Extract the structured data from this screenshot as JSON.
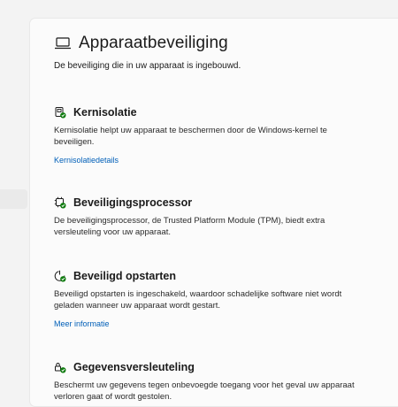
{
  "page": {
    "title": "Apparaatbeveiliging",
    "subtitle": "De beveiliging die in uw apparaat is ingebouwd."
  },
  "sections": [
    {
      "title": "Kernisolatie",
      "description": "Kernisolatie helpt uw apparaat te beschermen door de Windows-kernel te beveiligen.",
      "link": "Kernisolatiedetails",
      "icon": "core-isolation-icon"
    },
    {
      "title": "Beveiligingsprocessor",
      "description": "De beveiligingsprocessor, de Trusted Platform Module (TPM), biedt extra versleuteling voor uw apparaat.",
      "icon": "security-processor-icon"
    },
    {
      "title": "Beveiligd opstarten",
      "description": "Beveiligd opstarten is ingeschakeld, waardoor schadelijke software niet wordt geladen wanneer uw apparaat wordt gestart.",
      "link": "Meer informatie",
      "icon": "secure-boot-icon"
    },
    {
      "title": "Gegevensversleuteling",
      "description": "Beschermt uw gegevens tegen onbevoegde toegang voor het geval uw apparaat verloren gaat of wordt gestolen.",
      "icon": "data-encryption-icon"
    }
  ],
  "colors": {
    "accent_link": "#005fb8",
    "status_ok": "#107c10"
  }
}
